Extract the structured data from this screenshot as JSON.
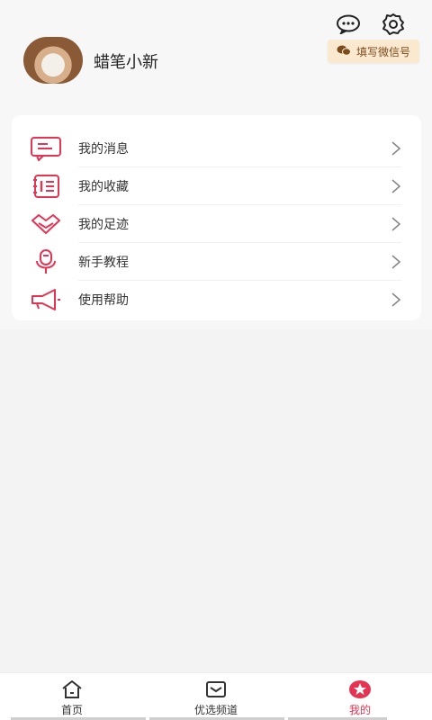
{
  "header": {
    "username": "蜡笔小新",
    "wechat_chip": "填写微信号",
    "icons": [
      "message-icon",
      "settings-icon"
    ]
  },
  "menu": [
    {
      "label": "我的消息",
      "icon": "message-icon"
    },
    {
      "label": "我的收藏",
      "icon": "collection-icon"
    },
    {
      "label": "我的足迹",
      "icon": "footprint-icon"
    },
    {
      "label": "新手教程",
      "icon": "tutorial-icon"
    },
    {
      "label": "使用帮助",
      "icon": "help-icon"
    }
  ],
  "tabbar": [
    {
      "label": "首页",
      "icon": "home-icon"
    },
    {
      "label": "优选频道",
      "icon": "channel-icon"
    },
    {
      "label": "我的",
      "icon": "profile-star-icon",
      "active": true
    }
  ],
  "colors": {
    "accent": "#e53353",
    "chip_bg": "#fbe9cf",
    "chip_text": "#7a4b1c"
  }
}
